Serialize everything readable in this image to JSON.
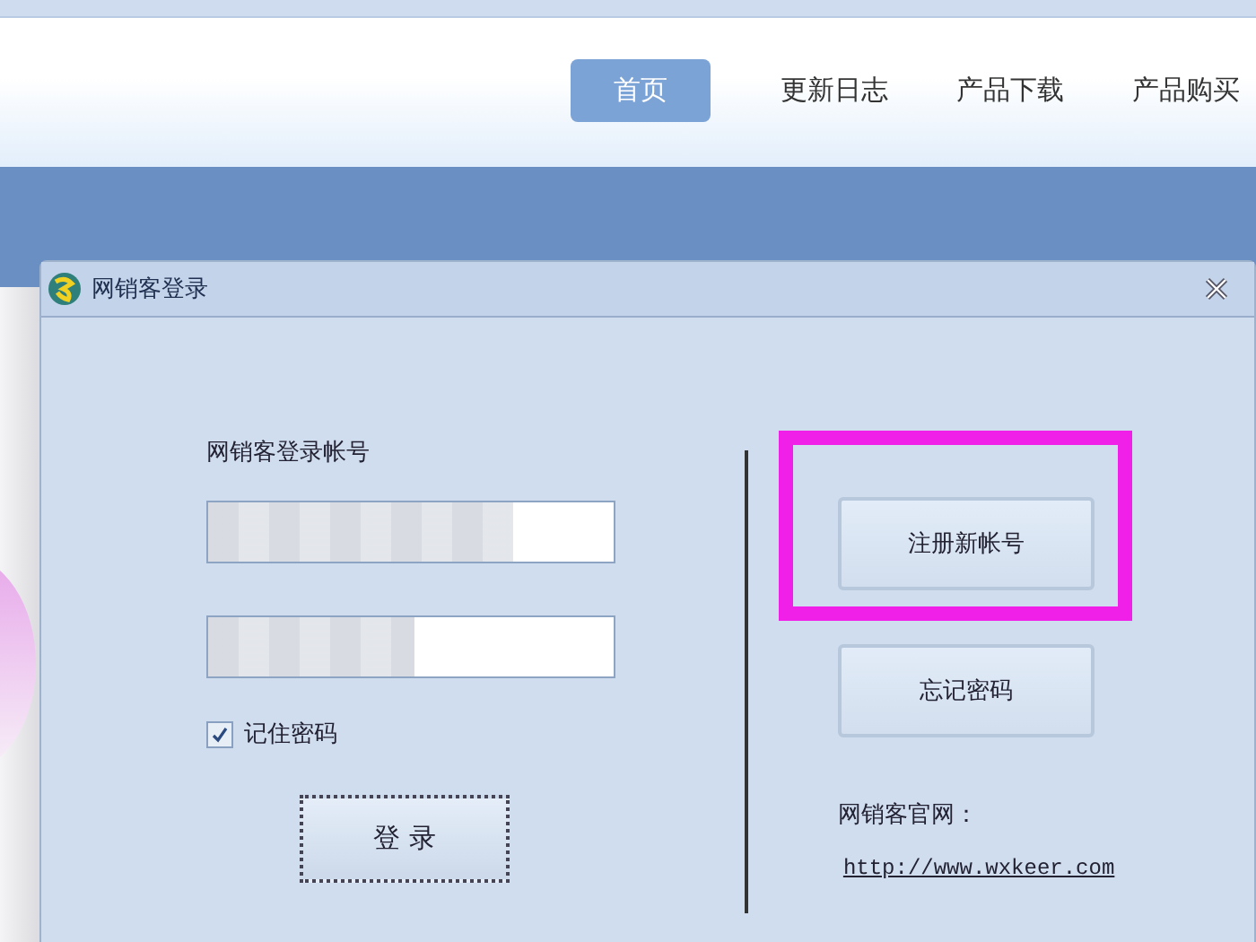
{
  "nav": [
    {
      "label": "首页",
      "selected": true
    },
    {
      "label": "更新日志",
      "selected": false
    },
    {
      "label": "产品下载",
      "selected": false
    },
    {
      "label": "产品购买",
      "selected": false
    }
  ],
  "dialog": {
    "title": "网销客登录",
    "account_label": "网销客登录帐号",
    "fields": [
      {
        "kind": "text",
        "blurred": true
      },
      {
        "kind": "password",
        "blurred": true
      }
    ],
    "remember": {
      "label": "记住密码",
      "checked": true
    },
    "login_button": "登 录",
    "buttons": [
      {
        "label": "注册新帐号",
        "highlighted": true
      },
      {
        "label": "忘记密码",
        "highlighted": false
      }
    ],
    "site_label": "网销客官网：",
    "site_link": "http://www.wxkeer.com"
  }
}
